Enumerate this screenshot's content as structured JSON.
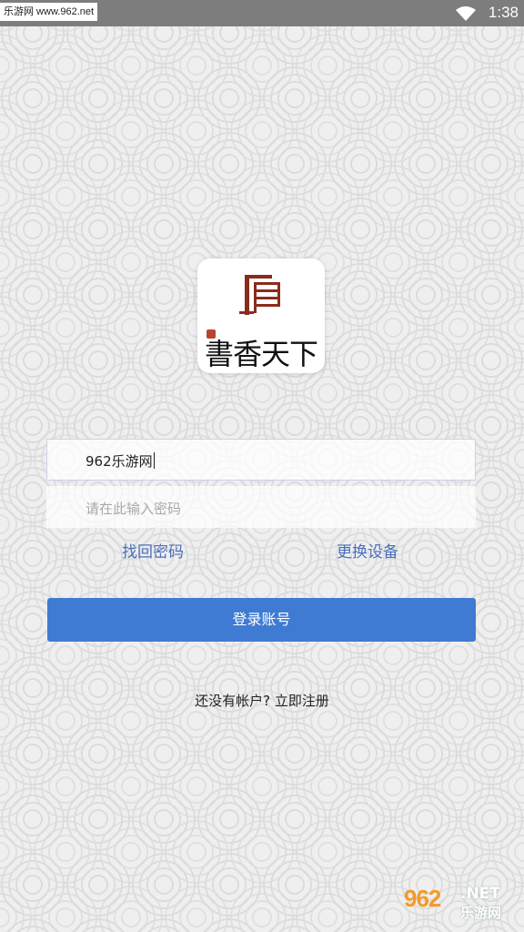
{
  "status_bar": {
    "source_label": "乐游网 www.962.net",
    "time": "1:38",
    "icons": [
      "wifi-icon",
      "battery-icon"
    ]
  },
  "logo": {
    "app_name": "書香天下",
    "icon": "book-seal-logo"
  },
  "form": {
    "username_value": "962乐游网",
    "password_placeholder": "请在此输入密码"
  },
  "links": {
    "forgot_password": "找回密码",
    "change_device": "更换设备"
  },
  "login_button": "登录账号",
  "register_prompt": "还没有帐户? 立即注册",
  "watermark": {
    "number": "962",
    "net": ".NET",
    "chinese": "乐游网"
  },
  "colors": {
    "primary": "#3f7bd3",
    "link": "#4a6fbd",
    "status_bar": "#7d7d7d",
    "seal_red": "#b8462e"
  }
}
